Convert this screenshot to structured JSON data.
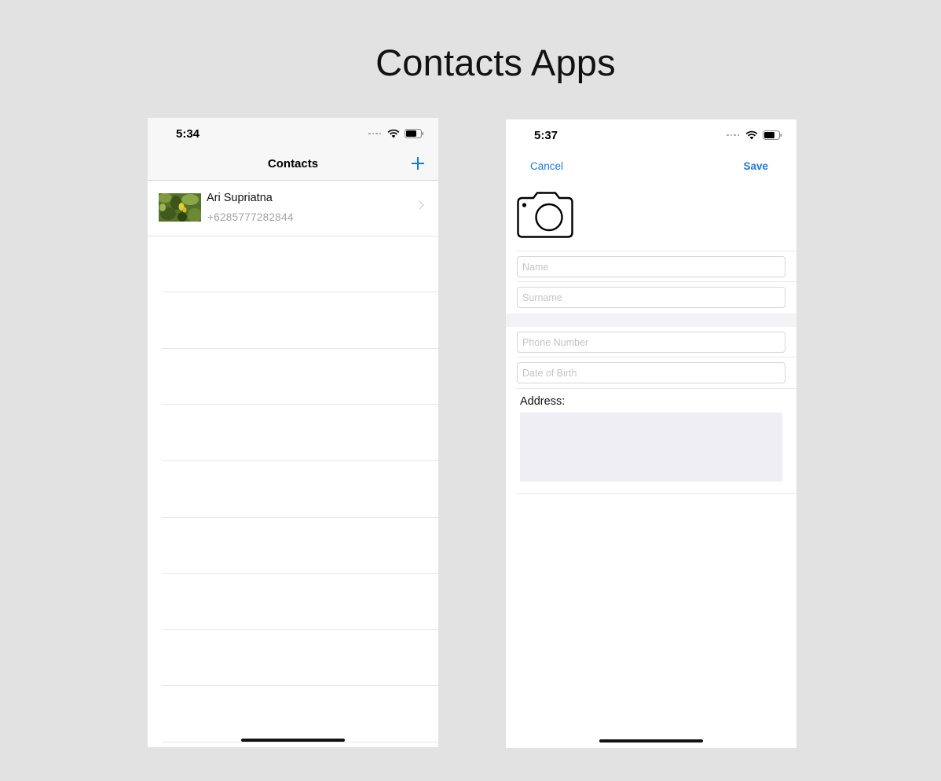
{
  "page": {
    "title": "Contacts Apps"
  },
  "list_screen": {
    "status": {
      "time": "5:34"
    },
    "nav": {
      "title": "Contacts",
      "add_icon": "plus-icon"
    },
    "contacts": [
      {
        "name": "Ari Supriatna",
        "phone": "+6285777282844",
        "photo": "leaves-photo"
      }
    ]
  },
  "form_screen": {
    "status": {
      "time": "5:37"
    },
    "nav": {
      "cancel_label": "Cancel",
      "save_label": "Save"
    },
    "photo_icon": "camera-icon",
    "fields": {
      "name_placeholder": "Name",
      "surname_placeholder": "Surname",
      "phone_placeholder": "Phone Number",
      "dob_placeholder": "Date of Birth"
    },
    "address_label": "Address:"
  },
  "colors": {
    "background": "#e2e2e2",
    "accent": "#1878e6",
    "secondary_text": "#a3a3a3"
  }
}
